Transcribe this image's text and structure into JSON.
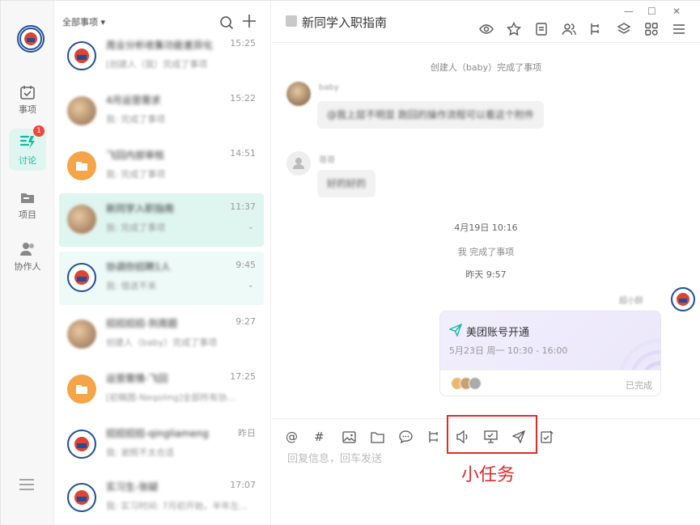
{
  "colors": {
    "accent": "#16b9a0",
    "badge": "#f0463c",
    "callout": "#e12b2b",
    "task_card": "#ede9fb",
    "active_bg": "#dff5f0"
  },
  "rail": {
    "items": [
      {
        "label": "事项",
        "icon": "calendar-check-icon",
        "active": false
      },
      {
        "label": "讨论",
        "icon": "chat-lightning-icon",
        "active": true,
        "badge": "1"
      },
      {
        "label": "项目",
        "icon": "folder-icon",
        "active": false
      },
      {
        "label": "协作人",
        "icon": "people-icon",
        "active": false
      }
    ],
    "menu_icon": "menu-icon"
  },
  "list": {
    "header": "全部事项 ▾",
    "conversations": [
      {
        "title": "周业分析收集功能差异化",
        "sub": "[创建人（我）完成了事项",
        "time": "15:25",
        "avatar": "emblem"
      },
      {
        "title": "4月运营需求",
        "sub": "我: 完成了事项",
        "time": "15:22",
        "avatar": "photo"
      },
      {
        "title": "飞回内部审核",
        "sub": "我: 完成了事项",
        "time": "14:51",
        "avatar": "orange"
      },
      {
        "title": "新同学入职指南",
        "sub": "我: 完成了事项",
        "time": "11:37",
        "avatar": "photo",
        "selected": true
      },
      {
        "title": "协调你招聘1人",
        "sub": "我: 借送不来",
        "time": "9:45",
        "avatar": "emblem",
        "pinned": true
      },
      {
        "title": "招招招招-到周题",
        "sub": "创建人（baby）完成了事项",
        "time": "9:27",
        "avatar": "photo"
      },
      {
        "title": "运营需情-飞回",
        "sub": "[初稿图-Neqoling]全部所有协...",
        "time": "17:25",
        "avatar": "orange"
      },
      {
        "title": "招招招招-qingliameng",
        "sub": "我: 谢照不太合适",
        "time": "昨日",
        "avatar": "emblem"
      },
      {
        "title": "实习生-张疑",
        "sub": "我: 实习时间: 7月初开始，半年左...",
        "time": "17:07",
        "avatar": "emblem"
      }
    ]
  },
  "chat": {
    "title": "新同学入职指南",
    "header_icons": [
      "eye-icon",
      "star-icon",
      "note-icon",
      "members-icon",
      "branch-icon",
      "layers-icon",
      "apps-icon",
      "menu-icon"
    ],
    "window_controls": [
      "—",
      "☐",
      "✕"
    ],
    "events": {
      "sys1": "创建人（baby）完成了事项",
      "sender1": "baby",
      "msg1": "@我上层不明显 跑回的操作流程可以看这个附件",
      "sender2": "哥哥",
      "msg2": "好的好的",
      "date1": "4月19日 10:16",
      "sys2": "我 完成了事项",
      "date2": "昨天 9:57",
      "self_name": "超小醉"
    },
    "task": {
      "title": "美团账号开通",
      "time": "5月23日 周一 10:30 - 16:00",
      "status": "已完成"
    },
    "composer": {
      "tools": [
        "@",
        "#",
        "image-icon",
        "folder-icon",
        "comment-icon",
        "flow-icon",
        "voice-icon",
        "task-board-icon",
        "send-plane-icon",
        "edit-check-icon"
      ],
      "placeholder": "回复信息，回车发送"
    },
    "annotation": "小任务"
  }
}
